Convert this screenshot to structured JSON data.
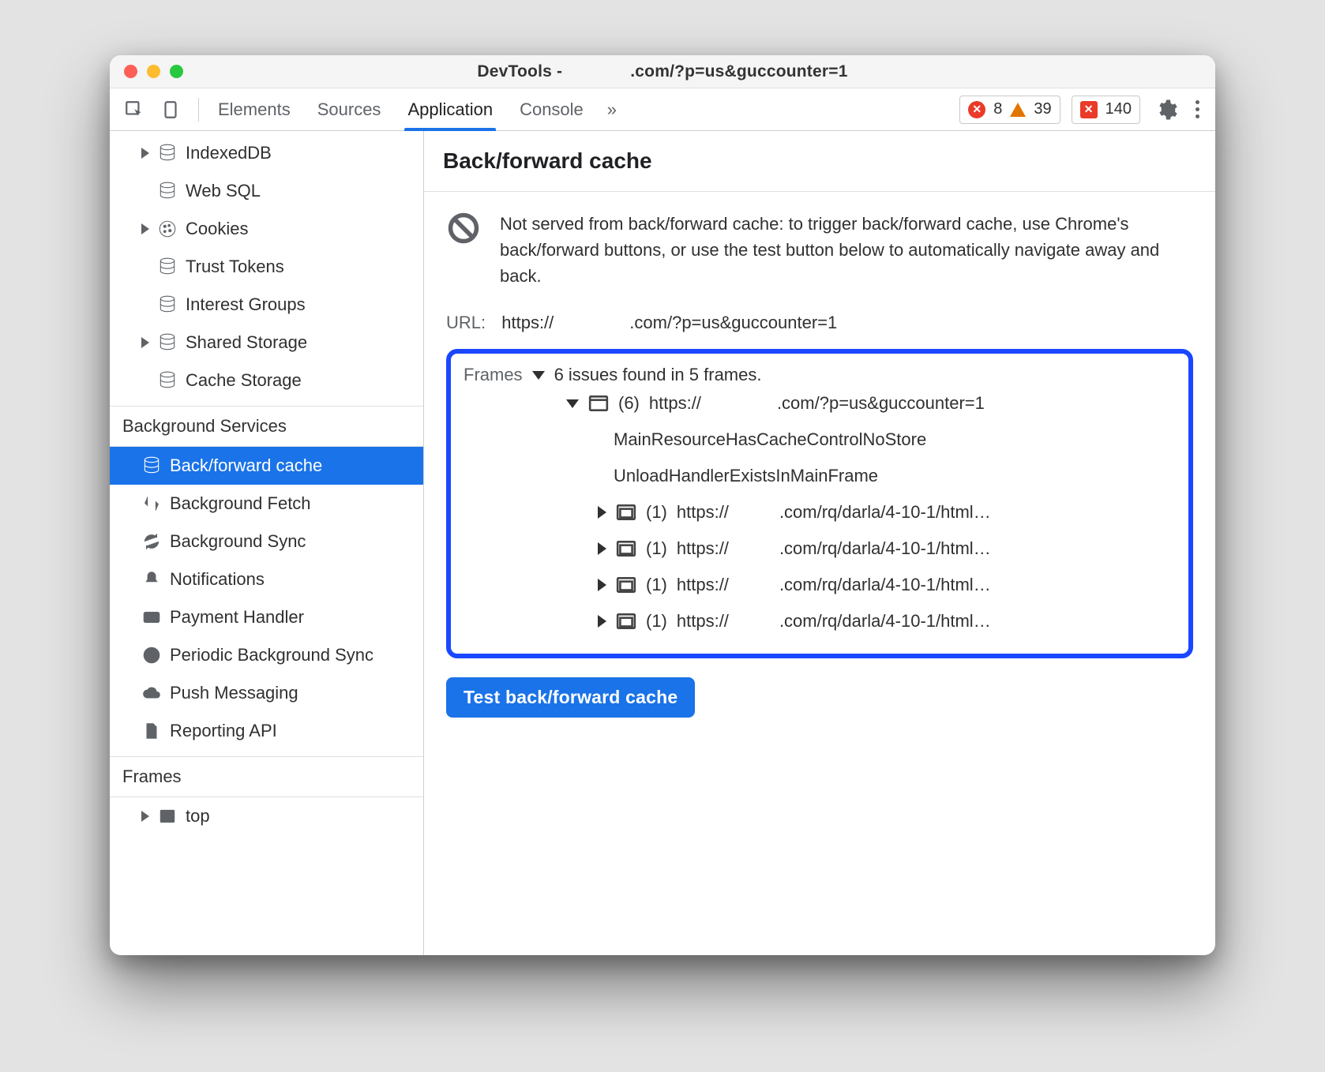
{
  "window": {
    "title_prefix": "DevTools - ",
    "title_suffix": ".com/?p=us&guccounter=1"
  },
  "toolbar": {
    "tabs": [
      "Elements",
      "Sources",
      "Application",
      "Console"
    ],
    "active_tab_index": 2,
    "overflow_glyph": "»",
    "error_count": "8",
    "warn_count": "39",
    "issue_count": "140"
  },
  "sidebar": {
    "storage_items": [
      {
        "label": "IndexedDB",
        "icon": "db",
        "expandable": true
      },
      {
        "label": "Web SQL",
        "icon": "db",
        "expandable": false
      },
      {
        "label": "Cookies",
        "icon": "cookie",
        "expandable": true
      },
      {
        "label": "Trust Tokens",
        "icon": "db",
        "expandable": false
      },
      {
        "label": "Interest Groups",
        "icon": "db",
        "expandable": false
      },
      {
        "label": "Shared Storage",
        "icon": "db",
        "expandable": true
      },
      {
        "label": "Cache Storage",
        "icon": "db",
        "expandable": false
      }
    ],
    "bg_section_label": "Background Services",
    "bg_items": [
      {
        "label": "Back/forward cache",
        "icon": "db",
        "selected": true
      },
      {
        "label": "Background Fetch",
        "icon": "fetch"
      },
      {
        "label": "Background Sync",
        "icon": "sync"
      },
      {
        "label": "Notifications",
        "icon": "bell"
      },
      {
        "label": "Payment Handler",
        "icon": "card"
      },
      {
        "label": "Periodic Background Sync",
        "icon": "clock"
      },
      {
        "label": "Push Messaging",
        "icon": "cloud"
      },
      {
        "label": "Reporting API",
        "icon": "file"
      }
    ],
    "frames_section_label": "Frames",
    "frames_items": [
      {
        "label": "top",
        "icon": "frame",
        "expandable": true
      }
    ]
  },
  "main": {
    "heading": "Back/forward cache",
    "notice": "Not served from back/forward cache: to trigger back/forward cache, use Chrome's back/forward buttons, or use the test button below to automatically navigate away and back.",
    "url_label": "URL:",
    "url_prefix": "https://",
    "url_suffix": ".com/?p=us&guccounter=1",
    "frames_label": "Frames",
    "frames_summary": "6 issues found in 5 frames.",
    "root_frame": {
      "count": "(6)",
      "prefix": "https://",
      "suffix": ".com/?p=us&guccounter=1",
      "reasons": [
        "MainResourceHasCacheControlNoStore",
        "UnloadHandlerExistsInMainFrame"
      ],
      "children": [
        {
          "count": "(1)",
          "prefix": "https://",
          "suffix": ".com/rq/darla/4-10-1/html…"
        },
        {
          "count": "(1)",
          "prefix": "https://",
          "suffix": ".com/rq/darla/4-10-1/html…"
        },
        {
          "count": "(1)",
          "prefix": "https://",
          "suffix": ".com/rq/darla/4-10-1/html…"
        },
        {
          "count": "(1)",
          "prefix": "https://",
          "suffix": ".com/rq/darla/4-10-1/html…"
        }
      ]
    },
    "test_button": "Test back/forward cache"
  }
}
